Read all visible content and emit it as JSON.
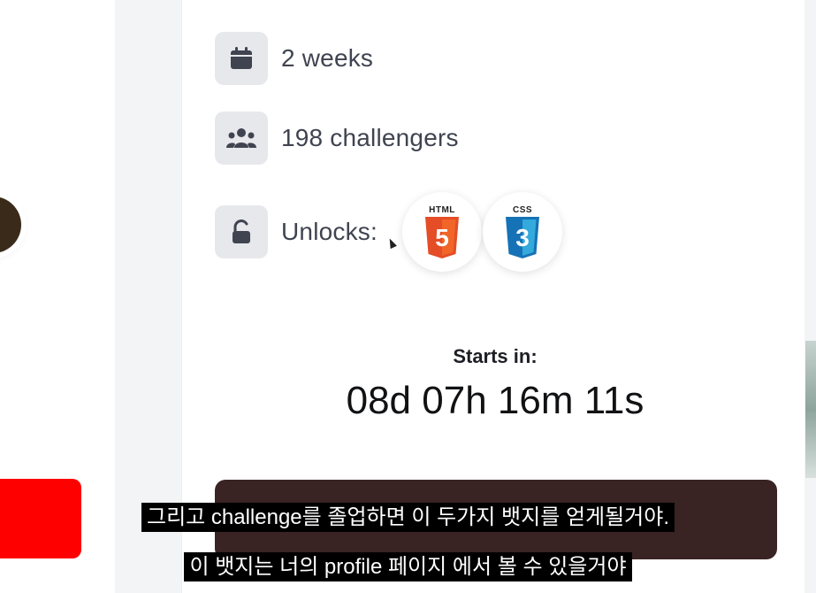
{
  "details": {
    "duration": "2 weeks",
    "challengers": "198 challengers",
    "unlocks_label": "Unlocks:"
  },
  "badges": [
    {
      "label": "HTML",
      "number": "5",
      "color": "#e44d26",
      "icon": "html5-icon"
    },
    {
      "label": "CSS",
      "number": "3",
      "color": "#1572b6",
      "icon": "css3-icon"
    }
  ],
  "countdown": {
    "label": "Starts in:",
    "value": "08d 07h 16m 11s"
  },
  "subtitles": {
    "line1": "그리고 challenge를 졸업하면 이 두가지 뱃지를 얻게될거야.",
    "line2": "이 뱃지는 너의 profile 페이지 에서 볼 수 있을거야"
  },
  "colors": {
    "icon_tile": "#e7e8ec",
    "cta": "#3a2323",
    "red_button": "#ff0000"
  }
}
